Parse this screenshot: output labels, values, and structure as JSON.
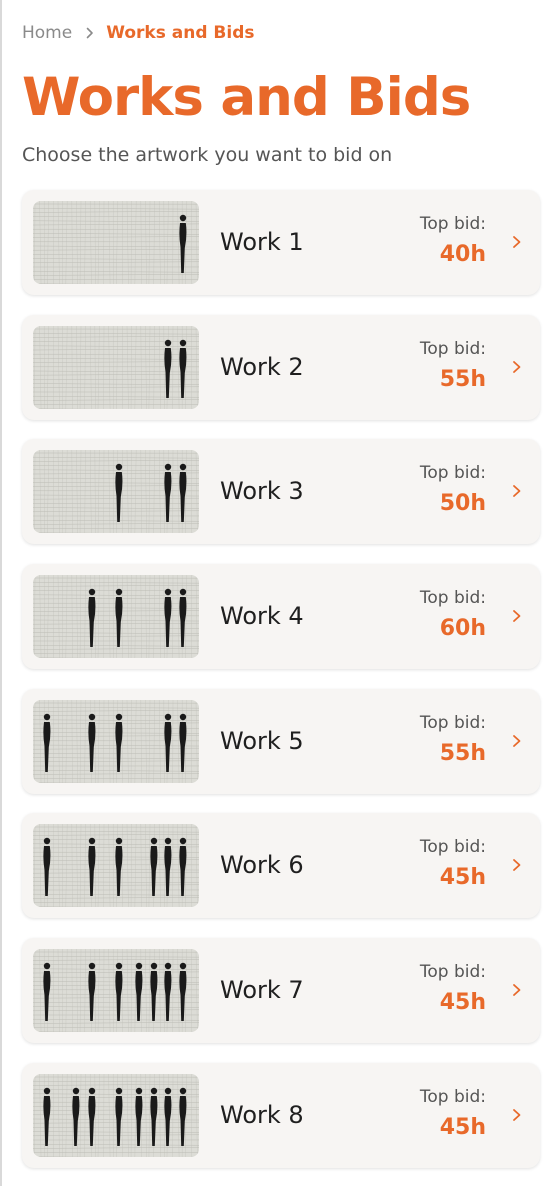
{
  "breadcrumb": {
    "home": "Home",
    "current": "Works and Bids"
  },
  "page": {
    "title": "Works and Bids",
    "subtitle": "Choose the artwork you want to bid on"
  },
  "works": [
    {
      "name": "Work 1",
      "bid_label": "Top bid:",
      "bid_value": "40h",
      "figures": 1
    },
    {
      "name": "Work 2",
      "bid_label": "Top bid:",
      "bid_value": "55h",
      "figures": 2
    },
    {
      "name": "Work 3",
      "bid_label": "Top bid:",
      "bid_value": "50h",
      "figures": 3
    },
    {
      "name": "Work 4",
      "bid_label": "Top bid:",
      "bid_value": "60h",
      "figures": 4
    },
    {
      "name": "Work 5",
      "bid_label": "Top bid:",
      "bid_value": "55h",
      "figures": 5
    },
    {
      "name": "Work 6",
      "bid_label": "Top bid:",
      "bid_value": "45h",
      "figures": 6
    },
    {
      "name": "Work 7",
      "bid_label": "Top bid:",
      "bid_value": "45h",
      "figures": 7
    },
    {
      "name": "Work 8",
      "bid_label": "Top bid:",
      "bid_value": "45h",
      "figures": 8
    }
  ],
  "icons": {
    "chevron": "chevron-right-icon",
    "separator": "chevron-right-icon"
  },
  "colors": {
    "accent": "#e8692a",
    "card_background": "#f7f5f3",
    "figure": "#1a1a1a",
    "mosaic": "#dcdcd6"
  }
}
